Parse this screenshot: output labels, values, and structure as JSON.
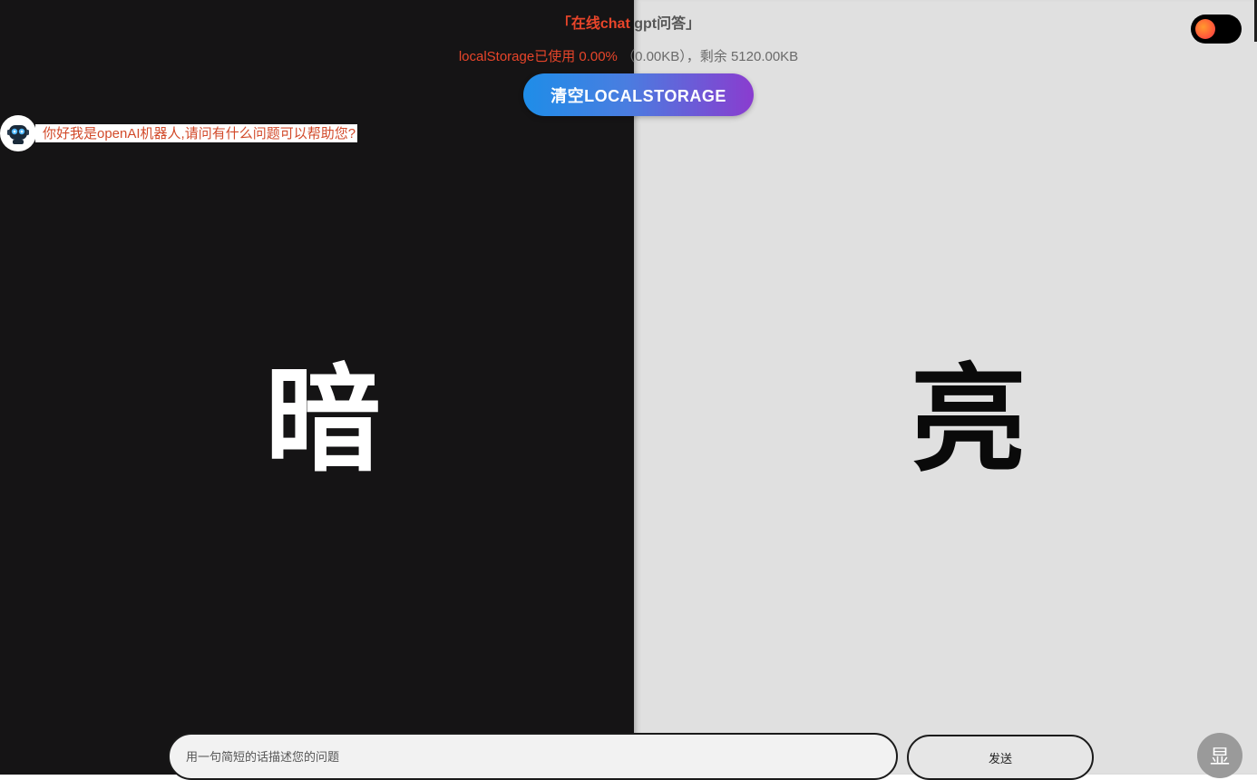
{
  "header": {
    "title_part1": "「在线chat",
    "title_part2": "gpt问答」",
    "usage_part1": "localStorage已使用 0.00%",
    "usage_part2": "（0.00KB），剩余 5120.00KB",
    "clear_button": "清空LOCALSTORAGE"
  },
  "theme_toggle": {
    "state": "dark"
  },
  "chat": {
    "messages": [
      {
        "role": "bot",
        "avatar_icon": "robot-icon",
        "text": "你好我是openAI机器人,请问有什么问题可以帮助您?"
      }
    ]
  },
  "panels": {
    "dark_label": "暗",
    "light_label": "亮"
  },
  "composer": {
    "placeholder": "用一句简短的话描述您的问题",
    "send_label": "发送",
    "show_label": "显"
  },
  "colors": {
    "accent_red": "#e8452a",
    "dark_bg": "#151415",
    "light_bg": "#e0e0e0",
    "gradient_start": "#1e8de8",
    "gradient_end": "#8a3ccf"
  }
}
